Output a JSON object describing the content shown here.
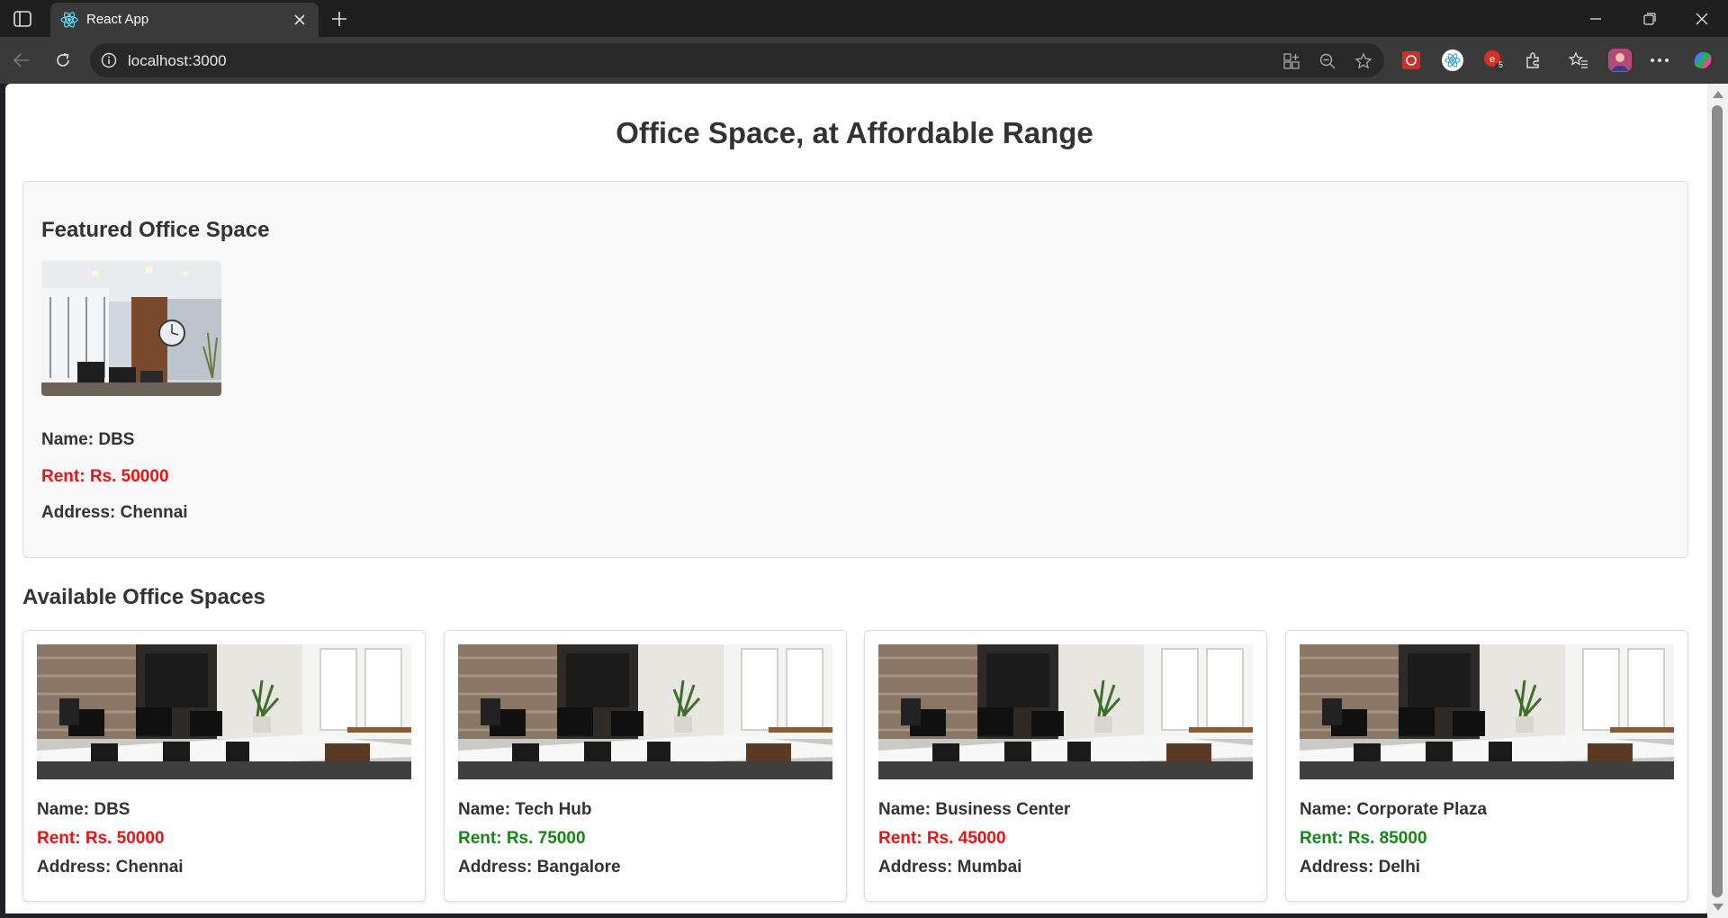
{
  "browser": {
    "tab_title": "React App",
    "url": "localhost:3000",
    "notification_badge": "5"
  },
  "page": {
    "title": "Office Space, at Affordable Range",
    "featured": {
      "heading": "Featured Office Space",
      "name": "Name: DBS",
      "rent": "Rent: Rs. 50000",
      "rent_color": "#ee1111",
      "address": "Address: Chennai"
    },
    "available_heading": "Available Office Spaces",
    "offices": [
      {
        "name": "Name: DBS",
        "rent": "Rent: Rs. 50000",
        "rent_color": "#ee1111",
        "address": "Address: Chennai"
      },
      {
        "name": "Name: Tech Hub",
        "rent": "Rent: Rs. 75000",
        "rent_color": "#118811",
        "address": "Address: Bangalore"
      },
      {
        "name": "Name: Business Center",
        "rent": "Rent: Rs. 45000",
        "rent_color": "#ee1111",
        "address": "Address: Mumbai"
      },
      {
        "name": "Name: Corporate Plaza",
        "rent": "Rent: Rs. 85000",
        "rent_color": "#118811",
        "address": "Address: Delhi"
      }
    ]
  },
  "icons": [
    "sidebar-toggle-icon",
    "react-favicon-icon",
    "close-icon",
    "plus-icon",
    "minimize-icon",
    "restore-icon",
    "window-close-icon",
    "back-icon",
    "reload-icon",
    "info-icon",
    "app-install-icon",
    "zoom-out-icon",
    "favorite-star-icon",
    "extension-icon",
    "favorites-icon",
    "profile-avatar",
    "more-icon",
    "copilot-icon"
  ]
}
